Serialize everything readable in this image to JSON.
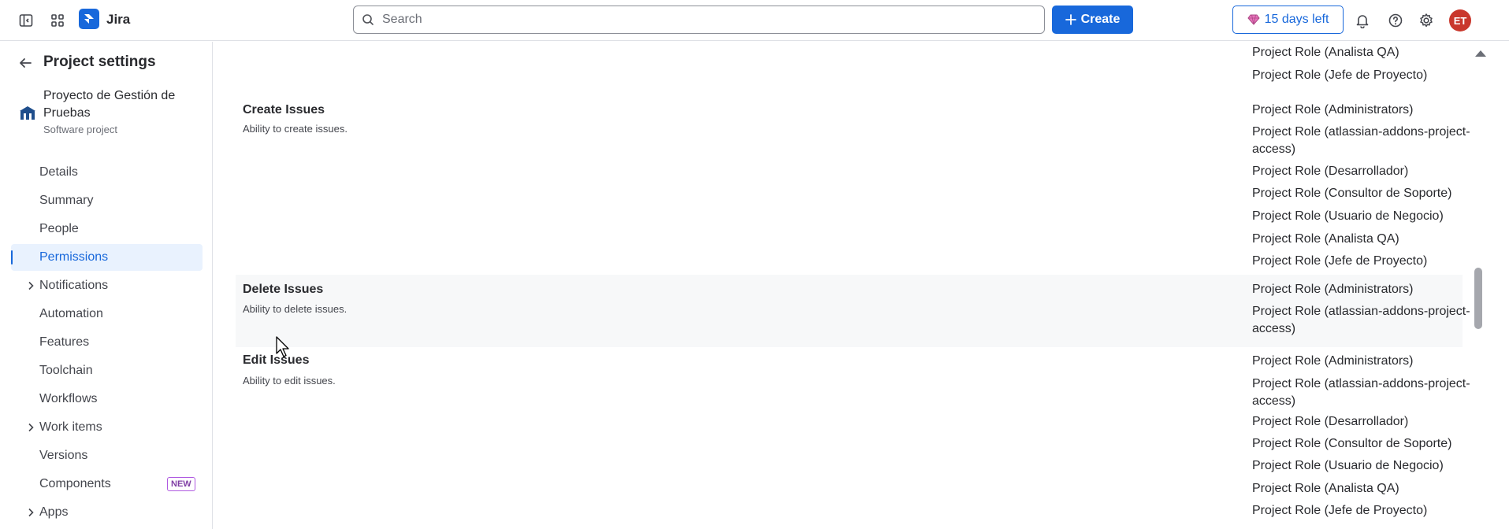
{
  "topbar": {
    "app_name": "Jira",
    "search_placeholder": "Search",
    "create_label": "Create",
    "trial_label": "15 days left",
    "avatar_initials": "ET",
    "brand_color": "#1868db",
    "avatar_color": "#c9372c"
  },
  "sidebar": {
    "title": "Project settings",
    "project_name": "Proyecto de Gestión de Pruebas",
    "project_type": "Software project",
    "items": [
      {
        "label": "Details",
        "expandable": false,
        "active": false
      },
      {
        "label": "Summary",
        "expandable": false,
        "active": false
      },
      {
        "label": "People",
        "expandable": false,
        "active": false
      },
      {
        "label": "Permissions",
        "expandable": false,
        "active": true
      },
      {
        "label": "Notifications",
        "expandable": true,
        "active": false
      },
      {
        "label": "Automation",
        "expandable": false,
        "active": false
      },
      {
        "label": "Features",
        "expandable": false,
        "active": false
      },
      {
        "label": "Toolchain",
        "expandable": false,
        "active": false
      },
      {
        "label": "Workflows",
        "expandable": false,
        "active": false
      },
      {
        "label": "Work items",
        "expandable": true,
        "active": false
      },
      {
        "label": "Versions",
        "expandable": false,
        "active": false
      },
      {
        "label": "Components",
        "expandable": false,
        "active": false,
        "badge": "NEW"
      },
      {
        "label": "Apps",
        "expandable": true,
        "active": false
      }
    ]
  },
  "permissions": {
    "previous_tail": [
      "Project Role (Analista QA)",
      "Project Role (Jefe de Proyecto)"
    ],
    "rows": [
      {
        "name": "Create Issues",
        "description": "Ability to create issues.",
        "grantees": [
          "Project Role (Administrators)",
          "Project Role (atlassian-addons-project-access)",
          "Project Role (Desarrollador)",
          "Project Role (Consultor de Soporte)",
          "Project Role (Usuario de Negocio)",
          "Project Role (Analista QA)",
          "Project Role (Jefe de Proyecto)"
        ]
      },
      {
        "name": "Delete Issues",
        "description": "Ability to delete issues.",
        "grantees": [
          "Project Role (Administrators)",
          "Project Role (atlassian-addons-project-access)"
        ]
      },
      {
        "name": "Edit Issues",
        "description": "Ability to edit issues.",
        "grantees": [
          "Project Role (Administrators)",
          "Project Role (atlassian-addons-project-access)",
          "Project Role (Desarrollador)",
          "Project Role (Consultor de Soporte)",
          "Project Role (Usuario de Negocio)",
          "Project Role (Analista QA)",
          "Project Role (Jefe de Proyecto)"
        ]
      }
    ]
  }
}
